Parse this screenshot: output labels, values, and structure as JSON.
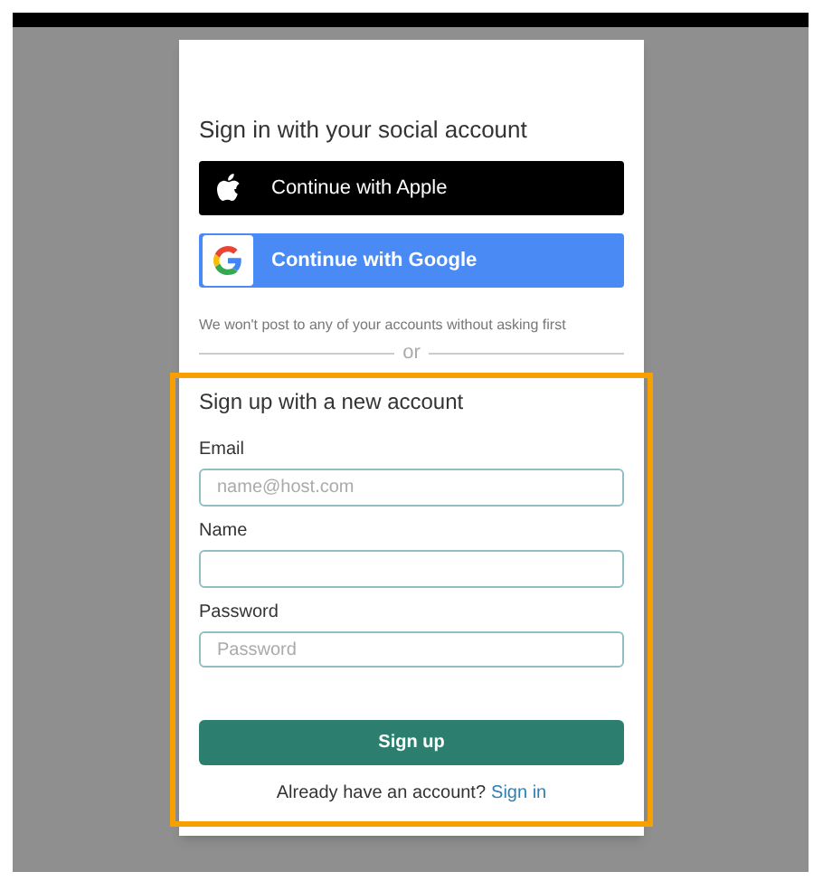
{
  "social": {
    "title": "Sign in with your social account",
    "buttons": [
      {
        "kind": "apple",
        "label": "Continue with Apple"
      },
      {
        "kind": "google",
        "label": "Continue with Google"
      }
    ],
    "note": "We won't post to any of your accounts without asking first"
  },
  "divider": "or",
  "signup": {
    "highlighted": true,
    "title": "Sign up with a new account",
    "fields": [
      {
        "label": "Email",
        "placeholder": "name@host.com"
      },
      {
        "label": "Name"
      },
      {
        "label": "Password",
        "placeholder": "Password"
      }
    ],
    "submit": "Sign up",
    "footer": "Already have an account?",
    "link": "Sign in"
  }
}
